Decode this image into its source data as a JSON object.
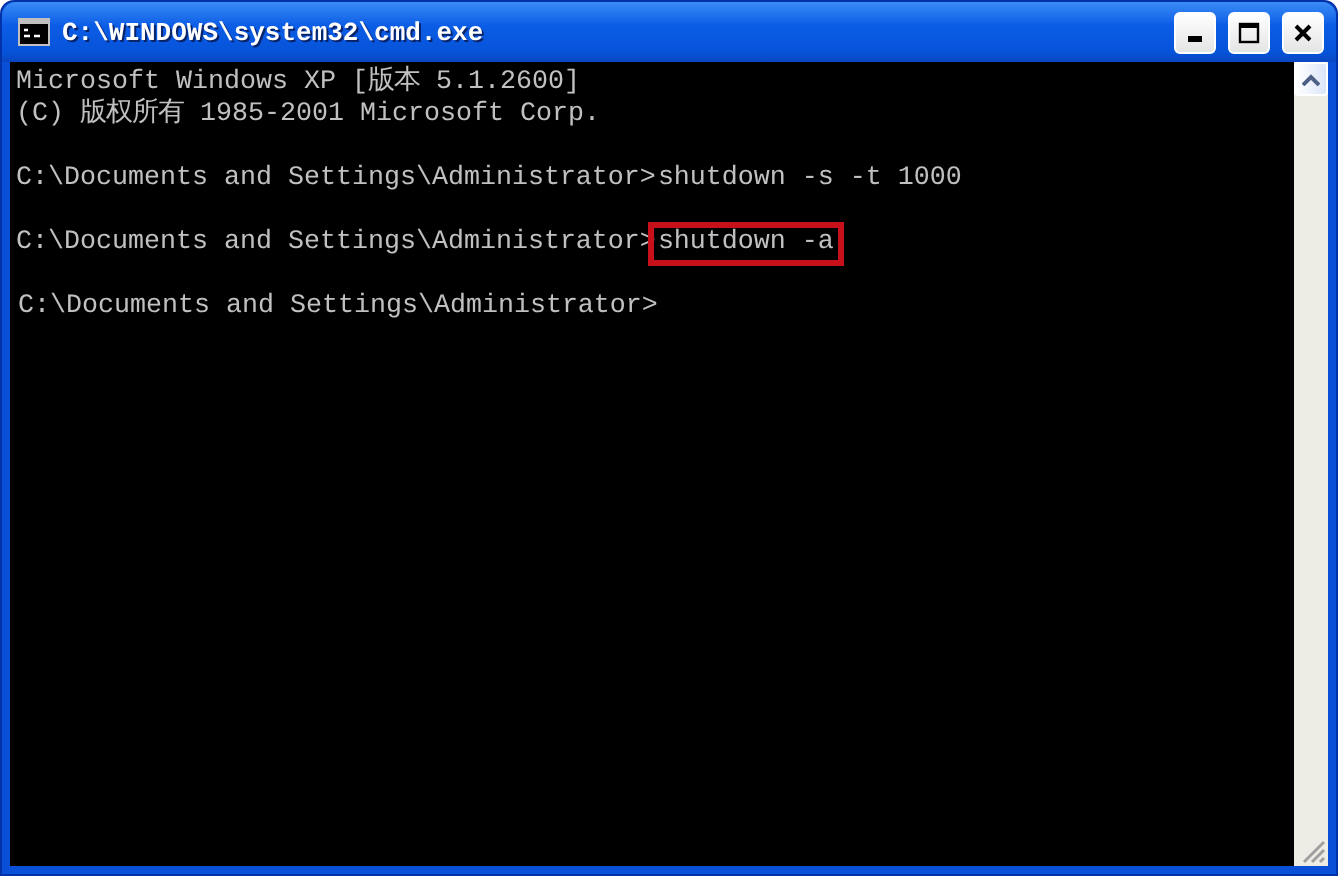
{
  "window": {
    "title": "C:\\WINDOWS\\system32\\cmd.exe"
  },
  "console": {
    "lines": [
      {
        "kind": "text",
        "text": "Microsoft Windows XP [版本 5.1.2600]"
      },
      {
        "kind": "text",
        "text": "(C) 版权所有 1985-2001 Microsoft Corp."
      },
      {
        "kind": "prompt",
        "prompt": "C:\\Documents and Settings\\Administrator>",
        "command": "shutdown -s -t 1000",
        "highlighted": false
      },
      {
        "kind": "prompt",
        "prompt": "C:\\Documents and Settings\\Administrator>",
        "command": "shutdown -a",
        "highlighted": true
      },
      {
        "kind": "prompt",
        "prompt": "C:\\Documents and Settings\\Administrator>",
        "highlighted": false
      }
    ]
  }
}
